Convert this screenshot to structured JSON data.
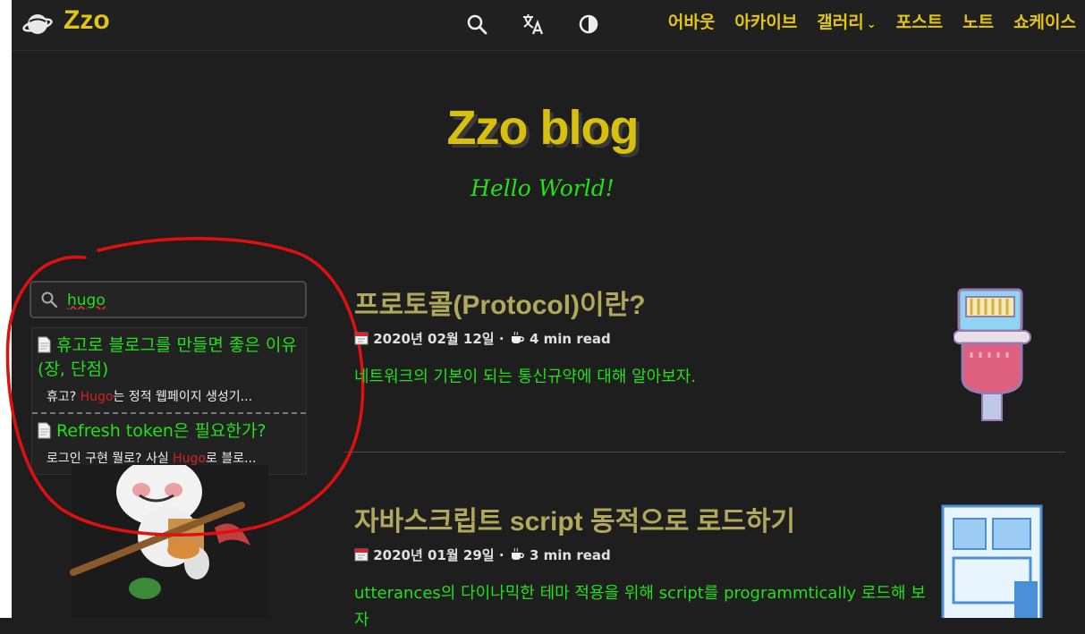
{
  "nav": {
    "logo": "Zzo",
    "icons": [
      "search-icon",
      "translate-icon",
      "theme-toggle-icon"
    ],
    "items": [
      {
        "label": "어바웃"
      },
      {
        "label": "아카이브"
      },
      {
        "label": "갤러리",
        "caret": "⌄"
      },
      {
        "label": "포스트"
      },
      {
        "label": "노트"
      },
      {
        "label": "쇼케이스"
      }
    ]
  },
  "hero": {
    "title": "Zzo blog",
    "subtitle": "Hello World!"
  },
  "search": {
    "value": "hugo",
    "results": [
      {
        "title": "휴고로 블로그를 만들면 좋은 이유(장, 단점)",
        "snippet_before": "휴고? ",
        "snippet_highlight": "Hugo",
        "snippet_after": "는 정적 웹페이지 생성기..."
      },
      {
        "title": "Refresh token은 필요한가?",
        "snippet_before": "로그인 구현 뭘로? 사실 ",
        "snippet_highlight": "Hugo",
        "snippet_after": "로 블로..."
      }
    ]
  },
  "posts": [
    {
      "title": "프로토콜(Protocol)이란?",
      "date": "2020년 02월 12일",
      "separator": "·",
      "read_time": "4 min read",
      "summary": "네트워크의 기본이 되는 통신규약에 대해 알아보자."
    },
    {
      "title": "자바스크립트 script 동적으로 로드하기",
      "date": "2020년 01월 29일",
      "separator": "·",
      "read_time": "3 min read",
      "summary": "utterances의 다이나믹한 테마 적용을 위해 script를 programmtically 로드해 보자"
    }
  ],
  "colors": {
    "accent": "#e3c514",
    "link_green": "#22e01a",
    "post_title": "#b0a85a",
    "highlight": "#d52020",
    "annotation": "#e01010"
  }
}
